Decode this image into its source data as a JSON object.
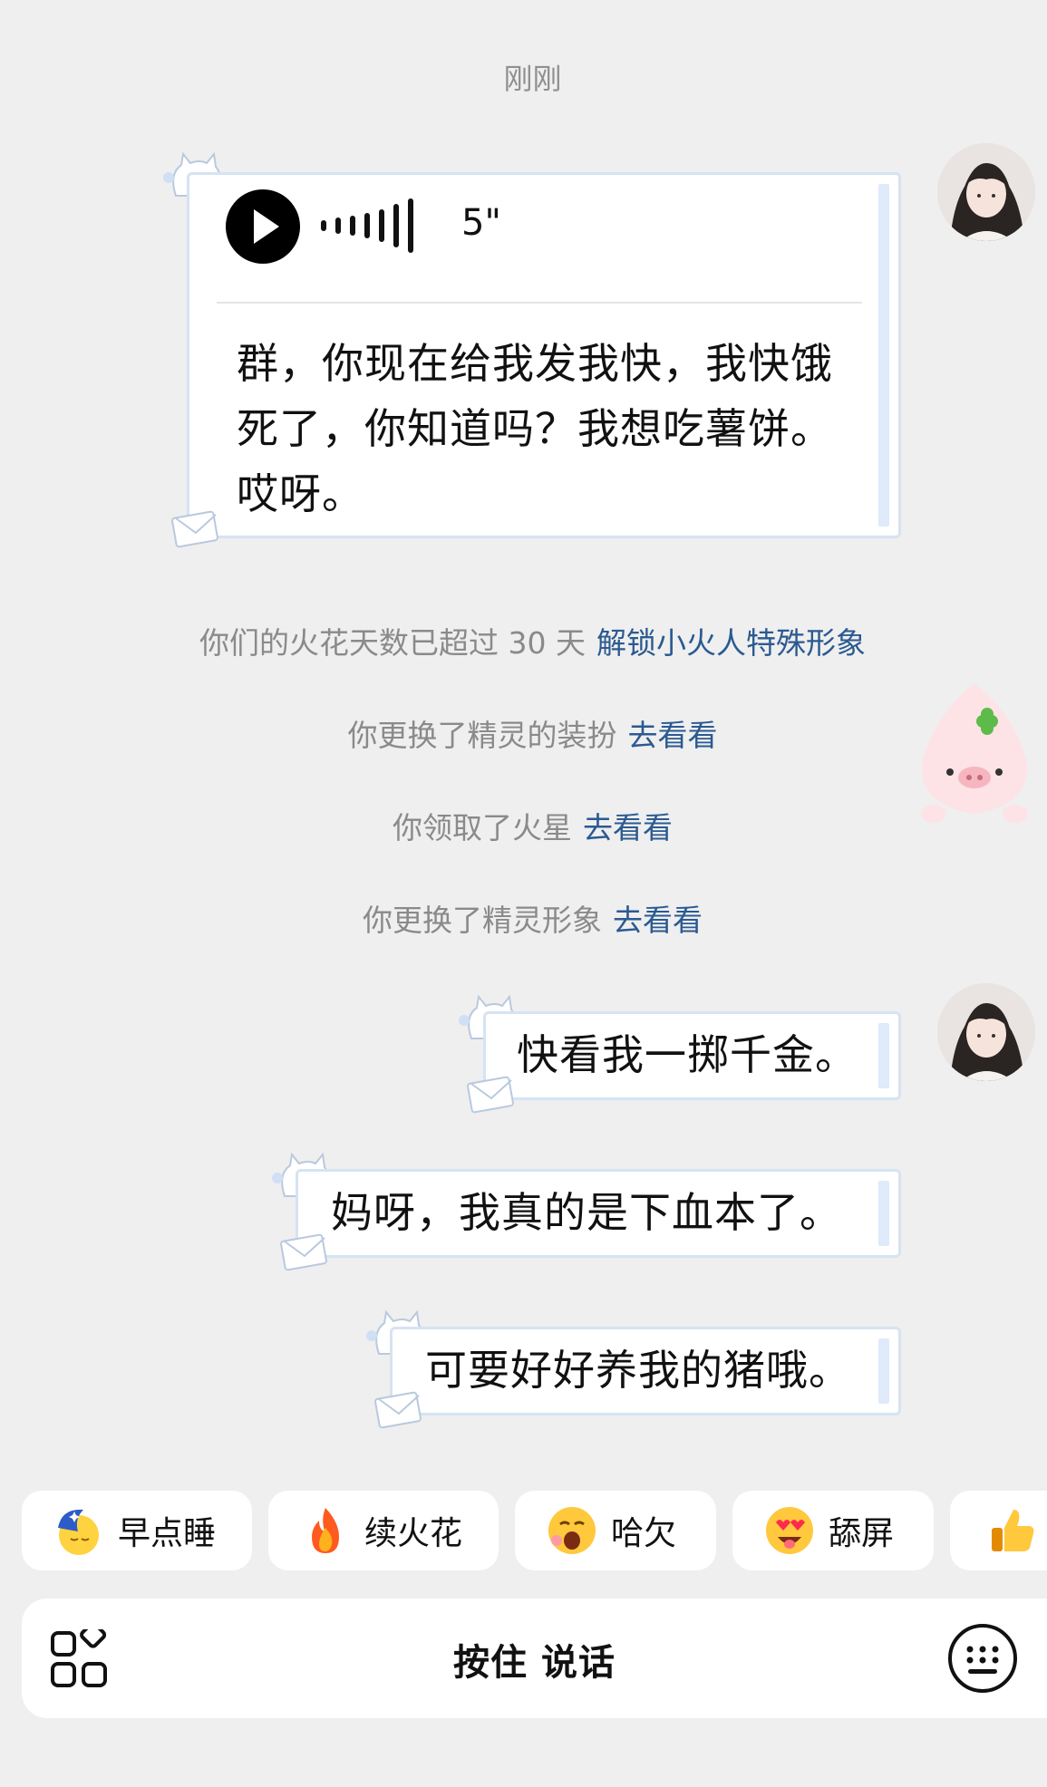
{
  "chat": {
    "timestamp": "刚刚",
    "voice_message": {
      "duration": "5\"",
      "transcript": "群，你现在给我发我快，我快饿死了，你知道吗？我想吃薯饼。哎呀。"
    },
    "notices": [
      {
        "text": "你们的火花天数已超过 30 天",
        "link": "解锁小火人特殊形象"
      },
      {
        "text": "你更换了精灵的装扮",
        "link": "去看看"
      },
      {
        "text": "你领取了火星",
        "link": "去看看"
      },
      {
        "text": "你更换了精灵形象",
        "link": "去看看"
      }
    ],
    "messages": [
      {
        "text": "快看我一掷千金。"
      },
      {
        "text": "妈呀，我真的是下血本了。"
      },
      {
        "text": "可要好好养我的猪哦。"
      }
    ]
  },
  "quick_replies": [
    {
      "label": "早点睡",
      "icon": "moon-sleep-icon"
    },
    {
      "label": "续火花",
      "icon": "fire-icon"
    },
    {
      "label": "哈欠",
      "icon": "yawn-face-icon"
    },
    {
      "label": "舔屏",
      "icon": "heart-eyes-face-icon"
    },
    {
      "label": "",
      "icon": "thumbs-up-icon"
    }
  ],
  "input_bar": {
    "hold_to_talk": "按住 说话"
  },
  "colors": {
    "background": "#efefef",
    "link": "#2b5a91",
    "notice_text": "#8a8a8a",
    "bubble_border": "#d6e3f2"
  }
}
